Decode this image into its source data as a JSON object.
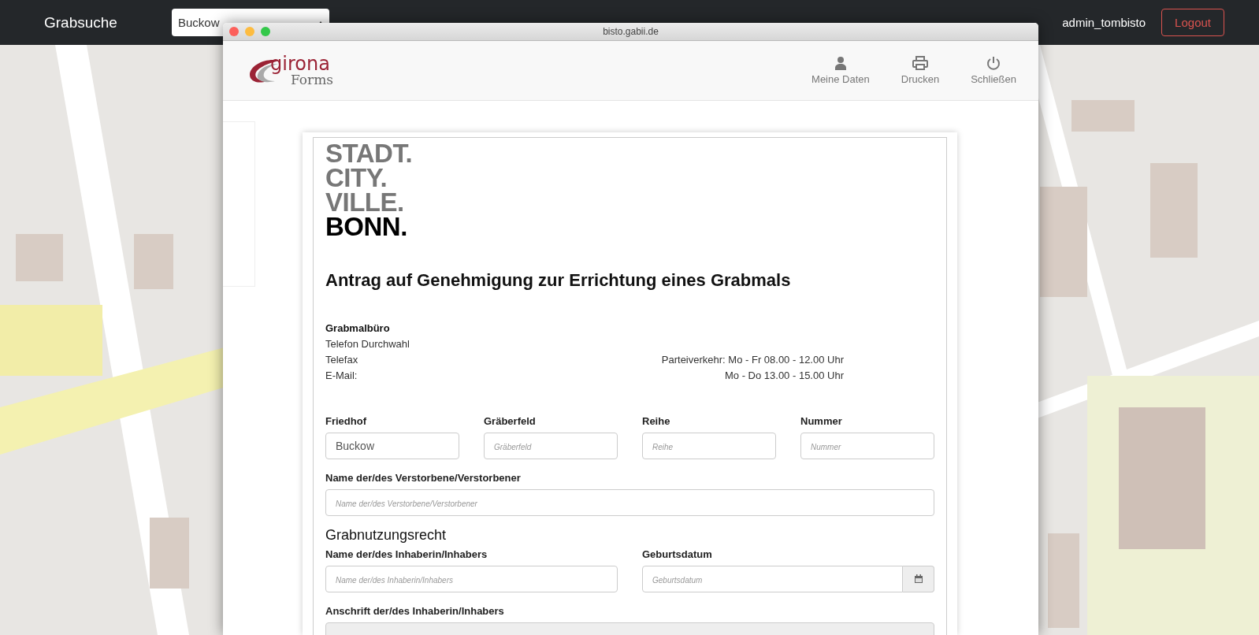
{
  "navbar": {
    "brand": "Grabsuche",
    "select": {
      "value": "Buckow"
    },
    "user": "admin_tombisto",
    "logout": "Logout"
  },
  "window": {
    "title": "bisto.gabii.de",
    "logo": {
      "word": "girona",
      "sub": "Forms"
    },
    "actions": [
      {
        "kind": "user",
        "label": "Meine Daten"
      },
      {
        "kind": "print",
        "label": "Drucken"
      },
      {
        "kind": "power",
        "label": "Schließen"
      }
    ]
  },
  "form": {
    "city_logo": [
      {
        "text": "STADT.",
        "emphasis": false
      },
      {
        "text": "CITY.",
        "emphasis": false
      },
      {
        "text": "VILLE.",
        "emphasis": false
      },
      {
        "text": "BONN.",
        "emphasis": true
      }
    ],
    "title": "Antrag auf Genehmigung zur Errichtung eines Grabmals",
    "office": {
      "heading": "Grabmalbüro",
      "lines": [
        "Telefon Durchwahl",
        "Telefax",
        "E-Mail:"
      ],
      "hours": [
        "Parteiverkehr: Mo - Fr 08.00 - 12.00 Uhr",
        "Mo - Do 13.00 - 15.00 Uhr"
      ]
    },
    "grave_fields": [
      {
        "label": "Friedhof",
        "value": "Buckow"
      },
      {
        "label": "Gräberfeld",
        "placeholder": "Gräberfeld"
      },
      {
        "label": "Reihe",
        "placeholder": "Reihe"
      },
      {
        "label": "Nummer",
        "placeholder": "Nummer"
      }
    ],
    "deceased": {
      "label": "Name der/des Verstorbene/Verstorbener",
      "placeholder": "Name der/des Verstorbene/Verstorbener"
    },
    "section": "Grabnutzungsrecht",
    "holder": {
      "label": "Name der/des Inhaberin/Inhabers",
      "placeholder": "Name der/des Inhaberin/Inhabers"
    },
    "birthdate": {
      "label": "Geburtsdatum",
      "placeholder": "Geburtsdatum"
    },
    "address": {
      "label": "Anschrift der/des Inhaberin/Inhabers"
    }
  }
}
